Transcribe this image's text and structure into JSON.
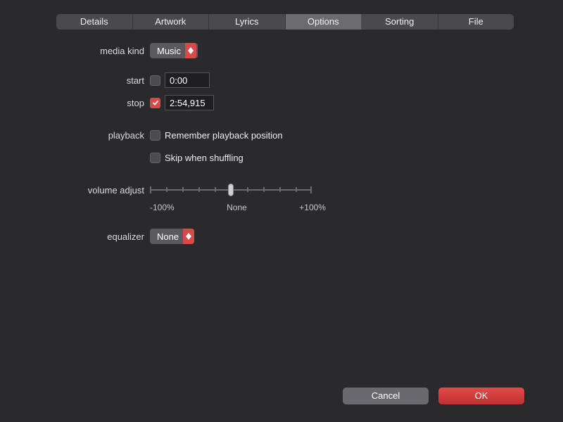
{
  "tabs": {
    "details": "Details",
    "artwork": "Artwork",
    "lyrics": "Lyrics",
    "options": "Options",
    "sorting": "Sorting",
    "file": "File",
    "active": "options"
  },
  "labels": {
    "media_kind": "media kind",
    "start": "start",
    "stop": "stop",
    "playback": "playback",
    "volume_adjust": "volume adjust",
    "equalizer": "equalizer"
  },
  "media_kind": {
    "value": "Music"
  },
  "start": {
    "checked": false,
    "value": "0:00"
  },
  "stop": {
    "checked": true,
    "value": "2:54,915"
  },
  "playback": {
    "remember": {
      "checked": false,
      "label": "Remember playback position"
    },
    "skip_shuffle": {
      "checked": false,
      "label": "Skip when shuffling"
    }
  },
  "volume_adjust": {
    "min_label": "-100%",
    "mid_label": "None",
    "max_label": "+100%",
    "value_percent": 50
  },
  "equalizer": {
    "value": "None"
  },
  "buttons": {
    "cancel": "Cancel",
    "ok": "OK"
  },
  "colors": {
    "accent": "#d84a4a",
    "background": "#2a2a2d"
  }
}
